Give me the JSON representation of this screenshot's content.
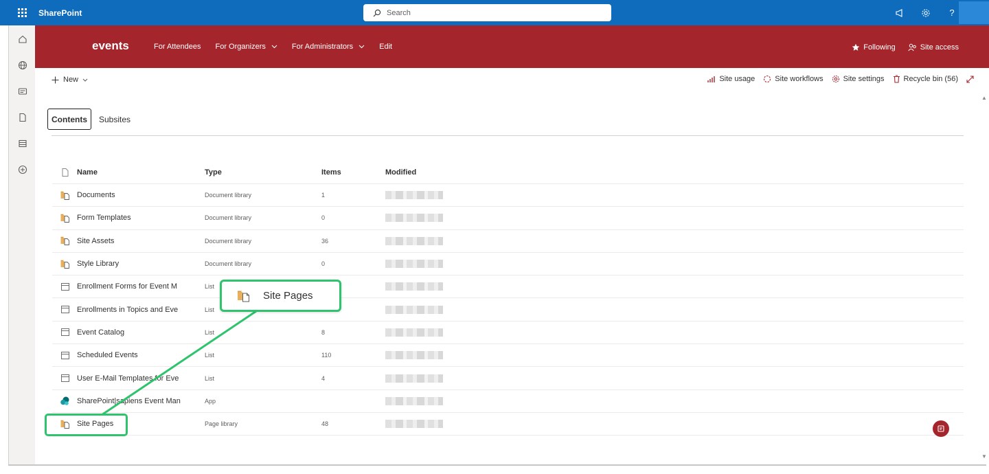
{
  "suite": {
    "brand": "SharePoint",
    "search_placeholder": "Search"
  },
  "site": {
    "title": "events",
    "nav": [
      {
        "label": "For Attendees",
        "dropdown": false
      },
      {
        "label": "For Organizers",
        "dropdown": true
      },
      {
        "label": "For Administrators",
        "dropdown": true
      },
      {
        "label": "Edit",
        "dropdown": false
      }
    ],
    "following_label": "Following",
    "site_access_label": "Site access"
  },
  "command_bar": {
    "new_label": "New",
    "site_usage": "Site usage",
    "site_workflows": "Site workflows",
    "site_settings": "Site settings",
    "recycle_bin": "Recycle bin (56)"
  },
  "pivots": {
    "contents": "Contents",
    "subsites": "Subsites"
  },
  "table": {
    "headers": {
      "name": "Name",
      "type": "Type",
      "items": "Items",
      "modified": "Modified"
    },
    "rows": [
      {
        "icon": "library-icon",
        "name": "Documents",
        "type": "Document library",
        "items": "1"
      },
      {
        "icon": "library-icon",
        "name": "Form Templates",
        "type": "Document library",
        "items": "0"
      },
      {
        "icon": "library-icon",
        "name": "Site Assets",
        "type": "Document library",
        "items": "36"
      },
      {
        "icon": "library-icon",
        "name": "Style Library",
        "type": "Document library",
        "items": "0"
      },
      {
        "icon": "list-icon",
        "name": "Enrollment Forms for Event M",
        "type": "List",
        "items": ""
      },
      {
        "icon": "list-icon",
        "name": "Enrollments in Topics and Eve",
        "type": "List",
        "items": ""
      },
      {
        "icon": "list-icon",
        "name": "Event Catalog",
        "type": "List",
        "items": "8"
      },
      {
        "icon": "list-icon",
        "name": "Scheduled Events",
        "type": "List",
        "items": "110"
      },
      {
        "icon": "list-icon",
        "name": "User E-Mail Templates for Eve",
        "type": "List",
        "items": "4"
      },
      {
        "icon": "app-icon",
        "name": "SharePoint|sapiens Event Man",
        "type": "App",
        "items": ""
      },
      {
        "icon": "library-icon",
        "name": "Site Pages",
        "type": "Page library",
        "items": "48"
      }
    ]
  },
  "callout": {
    "label": "Site Pages"
  },
  "colors": {
    "suite_blue": "#0f6cbd",
    "site_red": "#a4262c",
    "highlight_green": "#2fc36e"
  }
}
